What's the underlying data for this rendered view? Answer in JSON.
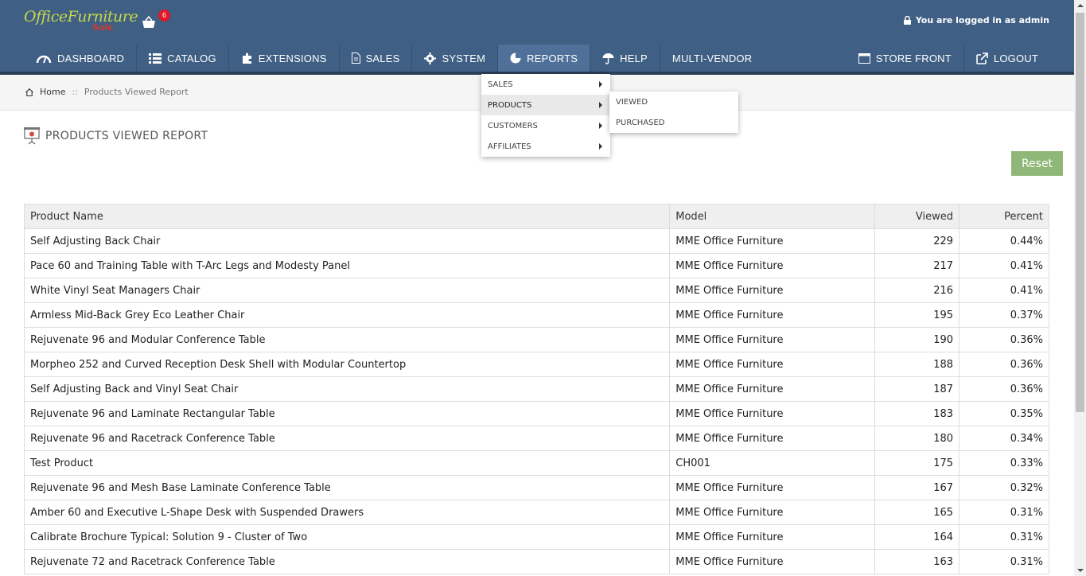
{
  "header": {
    "logo_text": "OfficeFurniture",
    "logo_sub": "Sale",
    "cart_count": "6",
    "login_text": "You are logged in as admin"
  },
  "nav": {
    "dashboard": "DASHBOARD",
    "catalog": "CATALOG",
    "extensions": "EXTENSIONS",
    "sales": "SALES",
    "system": "SYSTEM",
    "reports": "REPORTS",
    "help": "HELP",
    "multivendor": "MULTI-VENDOR",
    "storefront": "STORE FRONT",
    "logout": "LOGOUT"
  },
  "breadcrumb": {
    "home": "Home",
    "sep": "::",
    "current": "Products Viewed Report"
  },
  "page": {
    "title": "PRODUCTS VIEWED REPORT",
    "reset": "Reset"
  },
  "reports_menu": {
    "items": [
      "SALES",
      "PRODUCTS",
      "CUSTOMERS",
      "AFFILIATES"
    ],
    "active": "PRODUCTS",
    "products_sub": [
      "VIEWED",
      "PURCHASED"
    ]
  },
  "table": {
    "headers": [
      "Product Name",
      "Model",
      "Viewed",
      "Percent"
    ],
    "rows": [
      [
        "Self Adjusting Back Chair",
        "MME Office Furniture",
        "229",
        "0.44%"
      ],
      [
        "Pace 60 and Training Table with T-Arc Legs and Modesty Panel",
        "MME Office Furniture",
        "217",
        "0.41%"
      ],
      [
        "White Vinyl Seat Managers Chair",
        "MME Office Furniture",
        "216",
        "0.41%"
      ],
      [
        "Armless Mid-Back Grey Eco Leather Chair",
        "MME Office Furniture",
        "195",
        "0.37%"
      ],
      [
        "Rejuvenate 96 and Modular Conference Table",
        "MME Office Furniture",
        "190",
        "0.36%"
      ],
      [
        "Morpheo 252 and Curved Reception Desk Shell with Modular Countertop",
        "MME Office Furniture",
        "188",
        "0.36%"
      ],
      [
        "Self Adjusting Back and Vinyl Seat Chair",
        "MME Office Furniture",
        "187",
        "0.36%"
      ],
      [
        "Rejuvenate 96 and Laminate Rectangular Table",
        "MME Office Furniture",
        "183",
        "0.35%"
      ],
      [
        "Rejuvenate 96 and Racetrack Conference Table",
        "MME Office Furniture",
        "180",
        "0.34%"
      ],
      [
        "Test Product",
        "CH001",
        "175",
        "0.33%"
      ],
      [
        "Rejuvenate 96 and Mesh Base Laminate Conference Table",
        "MME Office Furniture",
        "167",
        "0.32%"
      ],
      [
        "Amber 60 and Executive L-Shape Desk with Suspended Drawers",
        "MME Office Furniture",
        "165",
        "0.31%"
      ],
      [
        "Calibrate Brochure Typical: Solution 9 - Cluster of Two",
        "MME Office Furniture",
        "164",
        "0.31%"
      ],
      [
        "Rejuvenate 72 and Racetrack Conference Table",
        "MME Office Furniture",
        "163",
        "0.31%"
      ]
    ]
  },
  "colors": {
    "header_bg": "#3f5f84",
    "nav_active": "#4f7199",
    "reset_bg": "#8fb878",
    "badge": "#e2172a"
  }
}
